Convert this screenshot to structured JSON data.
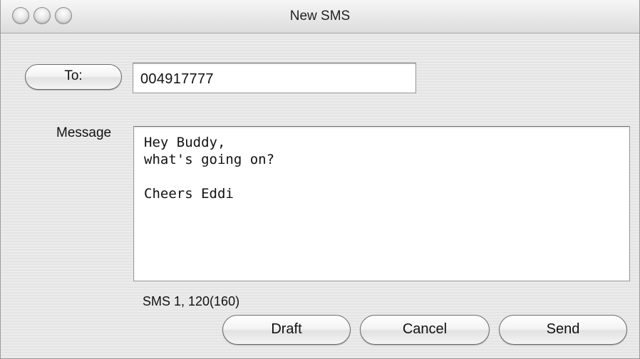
{
  "window": {
    "title": "New SMS"
  },
  "form": {
    "to_button_label": "To:",
    "to_value": "004917777",
    "message_label": "Message",
    "message_text": "Hey Buddy,\nwhat's going on?\n\nCheers Eddi",
    "status_text": "SMS 1, 120(160)"
  },
  "buttons": {
    "draft": "Draft",
    "cancel": "Cancel",
    "send": "Send"
  }
}
